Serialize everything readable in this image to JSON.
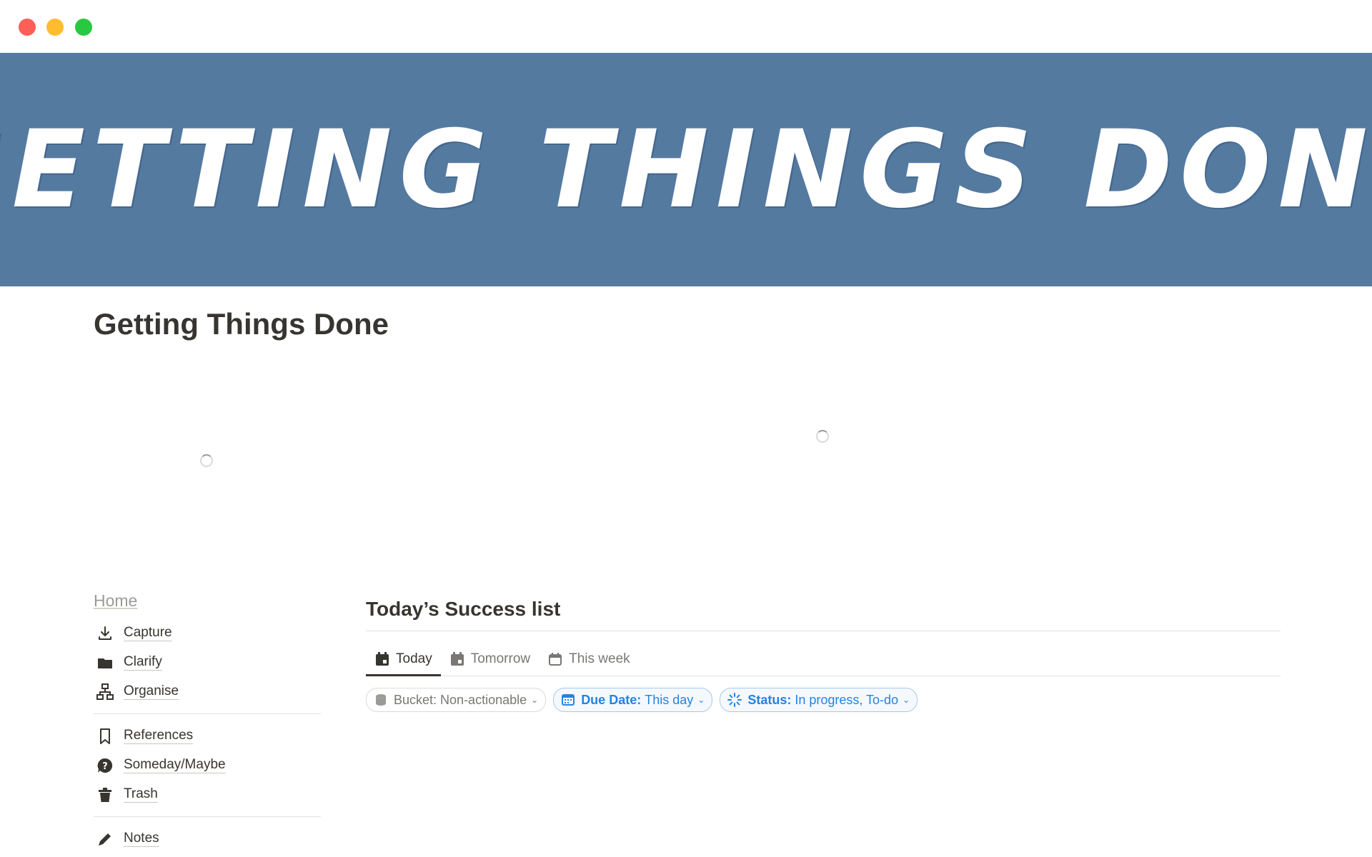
{
  "banner": {
    "text": "GETTING THINGS DONE"
  },
  "page": {
    "title": "Getting Things Done"
  },
  "nav": {
    "home_label": "Home",
    "group1": [
      {
        "label": "Capture",
        "icon": "download-icon"
      },
      {
        "label": "Clarify",
        "icon": "folder-icon"
      },
      {
        "label": "Organise",
        "icon": "hierarchy-icon"
      }
    ],
    "group2": [
      {
        "label": "References",
        "icon": "bookmark-icon"
      },
      {
        "label": "Someday/Maybe",
        "icon": "question-bubble-icon"
      },
      {
        "label": "Trash",
        "icon": "trash-icon"
      }
    ],
    "group3": [
      {
        "label": "Notes",
        "icon": "pencil-icon"
      }
    ]
  },
  "panel": {
    "title": "Today’s Success list",
    "tabs": [
      {
        "label": "Today",
        "active": true,
        "icon": "calendar-icon"
      },
      {
        "label": "Tomorrow",
        "active": false,
        "icon": "calendar-icon"
      },
      {
        "label": "This week",
        "active": false,
        "icon": "calendar-icon"
      }
    ],
    "filters": [
      {
        "key": "Bucket",
        "value": "Non-actionable",
        "icon": "database-icon",
        "style": "neutral"
      },
      {
        "key": "Due Date",
        "value": "This day",
        "icon": "calendar-icon",
        "style": "blue"
      },
      {
        "key": "Status",
        "value": "In progress, To-do",
        "icon": "status-icon",
        "style": "blue"
      }
    ]
  },
  "colors": {
    "banner_bg": "#547aa0",
    "accent_blue": "#2383e2",
    "text": "#37352f",
    "muted": "#787774"
  }
}
